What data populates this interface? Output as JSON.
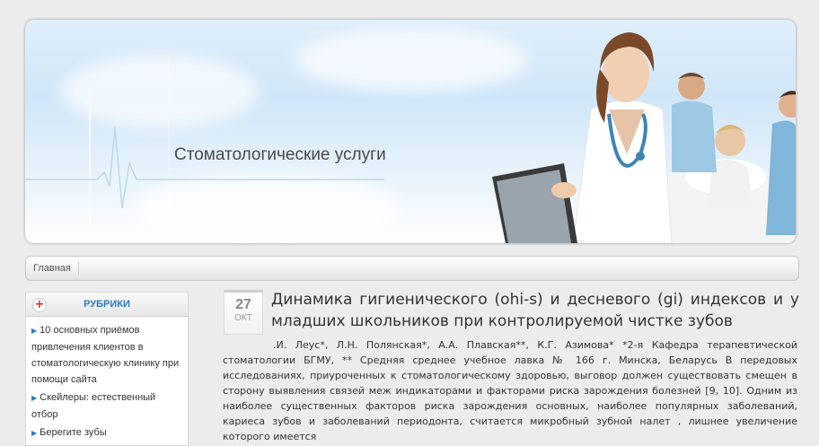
{
  "header": {
    "site_title": "Стоматологические услуги"
  },
  "navbar": {
    "items": [
      {
        "label": "Главная"
      }
    ]
  },
  "sidebar": {
    "widget_title": "РУБРИКИ",
    "items": [
      {
        "label": "10 основных приёмов привлечения клиентов в стоматологическую клинику при помощи сайта"
      },
      {
        "label": "Скейлеры: естественный отбор"
      },
      {
        "label": "Берегите зубы"
      }
    ]
  },
  "post": {
    "date_day": "27",
    "date_month": "ОКТ",
    "title": "Динамика гигиенического (ohi-s) и десневого (gi) индексов и у младших школьников при контролируемой чистке зубов",
    "body": ".И. Леус*, Л.Н. Полянская*, А.А. Плавская**, К.Г. Азимова* *2-я Кафедра терапевтической стоматологии БГМУ, ** Средняя среднее учебное лавка № 166 г. Минска, Беларусь В передовых исследованиях, приуроченных к стоматологическому здоровью, выговор должен существовать смещен в сторону выявления связей меж индикаторами и факторами риска зарождения болезней [9, 10]. Одним из наиболее существенных факторов риска зарождения основных, наиболее популярных заболеваний, кариеса зубов и заболеваний периодонта, считается микробный зубной налет , лишнее увеличение которого имеется"
  }
}
